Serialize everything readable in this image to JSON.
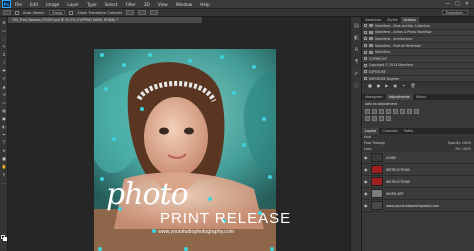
{
  "menu": {
    "logo": "Ps",
    "items": [
      "File",
      "Edit",
      "Image",
      "Layer",
      "Type",
      "Select",
      "Filter",
      "3D",
      "View",
      "Window",
      "Help"
    ],
    "win_controls": [
      "—",
      "□",
      "✕"
    ]
  },
  "options": {
    "auto_select": "Auto-Select:",
    "auto_select_value": "Group",
    "transform": "Show Transform Controls",
    "workspace": "Essentials"
  },
  "document": {
    "tab": "TSS_Print_Release_FRONT.psd @ 33.3% (CLIPPING MASK, RGB/8) *"
  },
  "artwork": {
    "headline": "photo",
    "subhead": "PRINT RELEASE",
    "url": "www.yourstudiophotography.com"
  },
  "panels": {
    "top_tabs": [
      "Swatches",
      "Styles",
      "Actions"
    ],
    "actions": [
      "Stashfens - Male and Bar Collection",
      "Stashfens - Action & Photo Workflow",
      "Stashfens - Architecture",
      "Stashfens - Portrait Perfection",
      "Stashfens",
      "COPYRIGHT",
      "Copyright © 2013 Stashfens",
      "EXPOSURE",
      "EXPOSURE Brighter"
    ],
    "adj_tabs": [
      "Histogram",
      "Adjustments",
      "Styles"
    ],
    "adj_title": "Add an adjustment",
    "layer_tabs": [
      "Layers",
      "Channels",
      "Paths"
    ],
    "kind": "Kind",
    "blend": "Pass Through",
    "opacity": "Opacity: 100%",
    "lock": "Lock:",
    "fill": "Fill: 100%",
    "layers": [
      {
        "name": "GUIDE",
        "thumb": "#3a3a3a"
      },
      {
        "name": "INSTRUCTIONS",
        "thumb": "#a01e22"
      },
      {
        "name": "INSTRUCTIONS",
        "thumb": "#a01e22"
      },
      {
        "name": "WORD ART",
        "thumb": "#7b7b7b"
      },
      {
        "name": "www.yourstudiophotography.com",
        "thumb": "#4a4a4a"
      }
    ]
  },
  "colors": {
    "accent": "#31a8ff",
    "dot": "#3ed2dd",
    "red_thumb": "#a01e22"
  }
}
